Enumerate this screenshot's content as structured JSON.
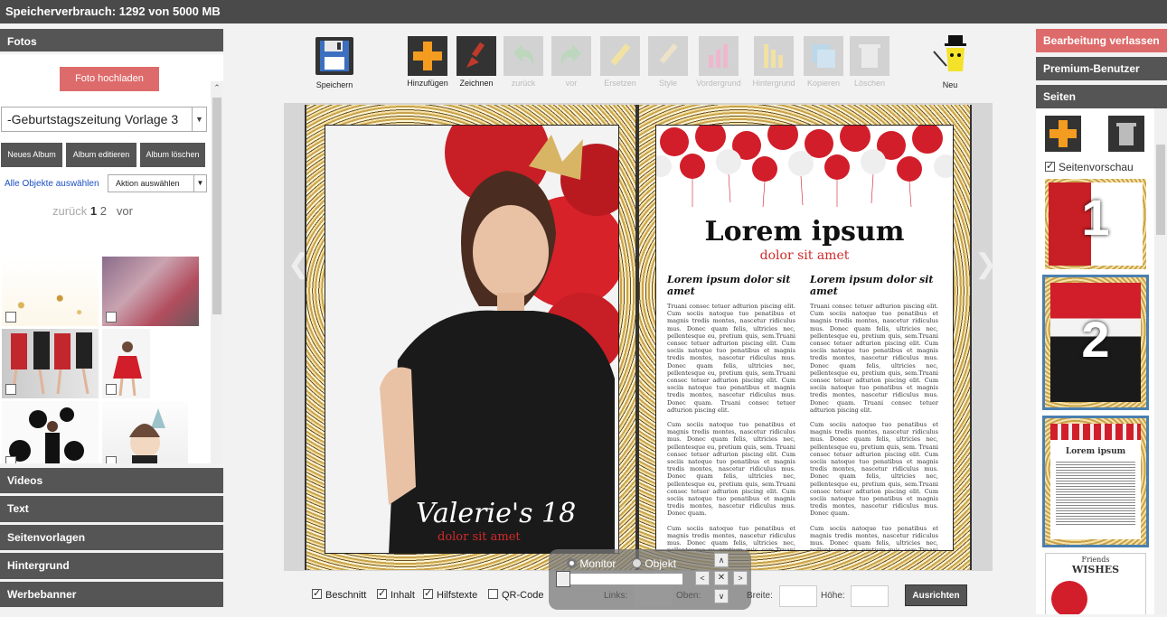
{
  "topbar": {
    "storage_text": "Speicherverbrauch: 1292 von 5000 MB"
  },
  "left": {
    "fotos_header": "Fotos",
    "upload_button": "Foto hochladen",
    "album_selected": "-Geburtstagszeitung Vorlage 3",
    "album_buttons": [
      "Neues Album",
      "Album editieren",
      "Album löschen"
    ],
    "select_all": "Alle Objekte auswählen",
    "action_select": "Aktion auswählen",
    "pager": {
      "prev": "zurück",
      "page1": "1",
      "page2": "2",
      "next": "vor"
    },
    "sections": [
      "Videos",
      "Text",
      "Seitenvorlagen",
      "Hintergrund",
      "Werbebanner"
    ]
  },
  "toolbar": {
    "save": "Speichern",
    "add": "Hinzufügen",
    "draw": "Zeichnen",
    "undo": "zurück",
    "redo": "vor",
    "replace": "Ersetzen",
    "style": "Style",
    "foreground": "Vordergrund",
    "background": "Hintergrund",
    "copy": "Kopieren",
    "delete": "Löschen",
    "new": "Neu"
  },
  "page_left": {
    "name": "Valerie's 18",
    "sub": "dolor sit amet"
  },
  "page_right": {
    "title": "Lorem ipsum",
    "subtitle": "dolor sit amet",
    "col_heading_1": "Lorem ipsum dolor sit amet",
    "col_heading_2": "Lorem ipsum dolor sit amet",
    "p1": "Truani consec tetuer adturion piscing elit. Cum sociis natoque tuo penatibus et magnis tredis montes, nascetur ridiculus mus. Donec quam felis, ultricies nec, pellentesque eu, pretium quis, sem.Truani consec tetuer adturion piscing elit. Cum sociis natoque tuo penatibus et magnis tredis montes, nascetur ridiculus mus. Donec quam felis, ultricies nec, pellentesque eu, pretium quis, sem.Truani consec tetuer adturion piscing elit. Cum sociis natoque tuo penatibus et magnis tredis montes, nascetur ridiculus mus. Donec quam. Truani consec tetuer adturion piscing elit.",
    "p2": "Cum sociis natoque tuo penatibus et magnis tredis montes, nascetur ridiculus mus. Donec quam felis, ultricies nec, pellentesque eu, pretium quis, sem. Truani consec tetuer adturion piscing elit. Cum sociis natoque tuo penatibus et magnis tredis montes, nascetur ridiculus mus. Donec quam felis, ultricies nec, pellentesque eu, pretium quis, sem.Truani consec tetuer adturion piscing elit. Cum sociis natoque tuo penatibus et magnis tredis montes, nascetur ridiculus mus. Donec quam.",
    "p3": "Cum sociis natoque tuo penatibus et magnis tredis montes, nascetur ridiculus mus. Donec quam felis, ultricies nec, pellentesque eu, pretium quis, sem.Truani consec tetuer adturion piscing elit. Cum sociis natoque tuo penatibus et magnis tredis montes, nascetur ridiculus mus. Donec quam felis, ultricies nec, pellentesque eu, pretium quis, sem. Cum sociis natoque tuo penatibus et magnis tredis montes, nascetur ridiculus mus. Cum sociis natoque tuo penatibus et magnis tredis montes, nascetur ridiculus mus. Cum sociis natoque tuo penatibus et magnis tredis montes, nascetur ridiculus mus. Cum sos nos. Donec quam."
  },
  "right": {
    "exit_edit": "Bearbeitung verlassen",
    "premium": "Premium-Benutzer",
    "pages_header": "Seiten",
    "preview_label": "Seitenvorschau",
    "thumb_nums": [
      "1",
      "2"
    ],
    "thumb3_title": "Lorem ipsum",
    "thumb4_title": "Friends",
    "thumb4_sub": "WISHES"
  },
  "bottom": {
    "beschnitt": "Beschnitt",
    "inhalt": "Inhalt",
    "hilfstexte": "Hilfstexte",
    "qrcode": "QR-Code",
    "monitor": "Monitor",
    "objekt": "Objekt",
    "links": "Links:",
    "oben": "Oben:",
    "breite": "Breite:",
    "hoehe": "Höhe:",
    "ausrichten": "Ausrichten"
  },
  "colors": {
    "accent": "#de6b6b",
    "dark": "#555555",
    "highlight": "#4a7fb0"
  }
}
